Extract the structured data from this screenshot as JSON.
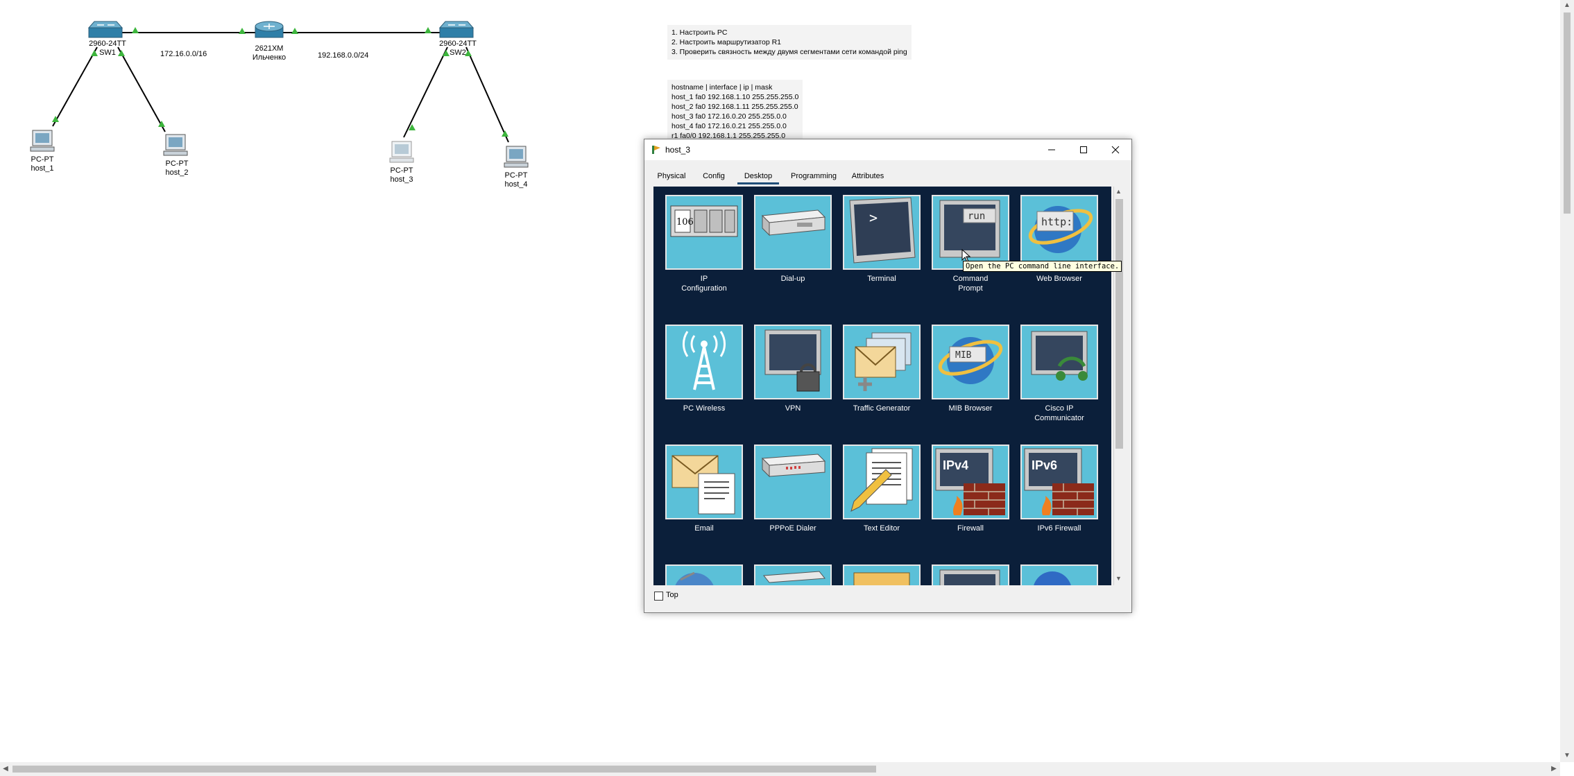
{
  "network": {
    "devices": [
      {
        "id": "sw1",
        "model": "2960-24TT",
        "name": "SW1"
      },
      {
        "id": "r1",
        "model": "2621XM",
        "name": "Ильченко"
      },
      {
        "id": "sw2",
        "model": "2960-24TT",
        "name": "SW2"
      },
      {
        "id": "h1",
        "model": "PC-PT",
        "name": "host_1"
      },
      {
        "id": "h2",
        "model": "PC-PT",
        "name": "host_2"
      },
      {
        "id": "h3",
        "model": "PC-PT",
        "name": "host_3"
      },
      {
        "id": "h4",
        "model": "PC-PT",
        "name": "host_4"
      }
    ],
    "net_left": "172.16.0.0/16",
    "net_right": "192.168.0.0/24"
  },
  "notes": {
    "tasks": "1. Настроить PC\n2. Настроить маршрутизатор R1\n3. Проверить связность между двумя сегментами сети командой ping",
    "table": "hostname | interface | ip | mask\nhost_1 fa0 192.168.1.10 255.255.255.0\nhost_2 fa0 192.168.1.11 255.255.255.0\nhost_3 fa0 172.16.0.20 255.255.0.0\nhost_4 fa0 172.16.0.21 255.255.0.0\nr1 fa0/0 192.168.1.1 255.255.255.0"
  },
  "dialog": {
    "title": "host_3",
    "tabs": [
      "Physical",
      "Config",
      "Desktop",
      "Programming",
      "Attributes"
    ],
    "active_tab": "Desktop",
    "apps": [
      {
        "label": "IP\nConfiguration",
        "icon": "ip-configuration-icon"
      },
      {
        "label": "Dial-up",
        "icon": "dial-up-modem-icon"
      },
      {
        "label": "Terminal",
        "icon": "terminal-icon"
      },
      {
        "label": "Command\nPrompt",
        "icon": "command-prompt-icon"
      },
      {
        "label": "Web Browser",
        "icon": "web-browser-icon"
      },
      {
        "label": "PC Wireless",
        "icon": "wireless-antenna-icon"
      },
      {
        "label": "VPN",
        "icon": "vpn-lock-icon"
      },
      {
        "label": "Traffic Generator",
        "icon": "traffic-generator-icon"
      },
      {
        "label": "MIB Browser",
        "icon": "mib-browser-icon"
      },
      {
        "label": "Cisco IP Communicator",
        "icon": "ip-communicator-icon"
      },
      {
        "label": "Email",
        "icon": "email-icon"
      },
      {
        "label": "PPPoE Dialer",
        "icon": "pppoe-dialer-icon"
      },
      {
        "label": "Text Editor",
        "icon": "text-editor-icon"
      },
      {
        "label": "Firewall",
        "icon": "ipv4-firewall-icon"
      },
      {
        "label": "IPv6 Firewall",
        "icon": "ipv6-firewall-icon"
      }
    ],
    "icon_text": {
      "ip": "106",
      "run": "run",
      "http": "http:",
      "mib": "MIB",
      "ipv4": "IPv4",
      "ipv6": "IPv6",
      "prompt": ">"
    },
    "tooltip": "Open the PC command line interface.",
    "top_checkbox_label": "Top"
  },
  "colors": {
    "link": "#000000",
    "port_up": "#3db53d",
    "tile": "#5bc0d8",
    "panel": "#0b1f3a"
  }
}
